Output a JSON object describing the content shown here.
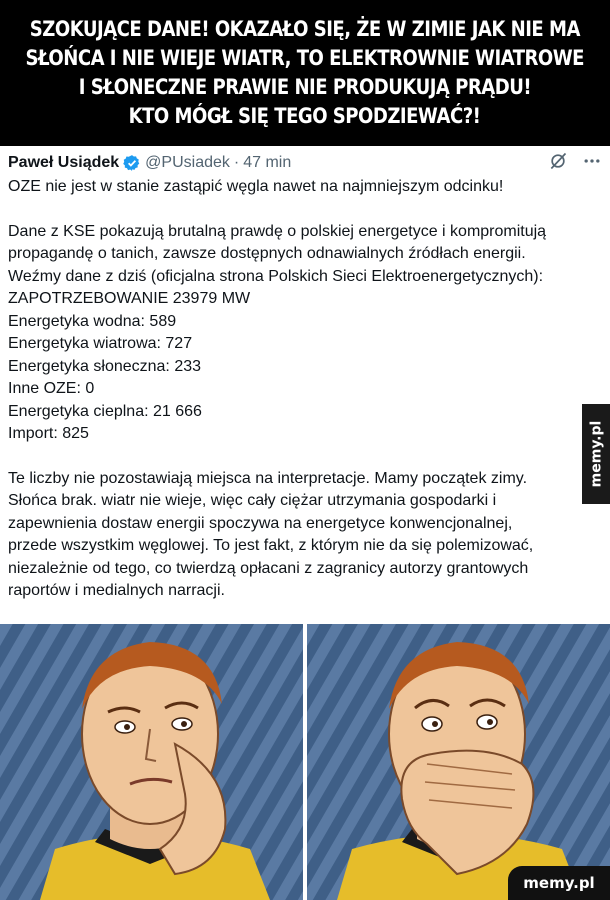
{
  "headline": {
    "lines": [
      "SZOKUJĄCE DANE! OKAZAŁO SIĘ, ŻE W ZIMIE JAK NIE MA",
      "SŁOŃCA I NIE WIEJE WIATR, TO ELEKTROWNIE WIATROWE",
      "I SŁONECZNE PRAWIE NIE PRODUKUJĄ PRĄDU!",
      "KTO MÓGŁ SIĘ TEGO SPODZIEWAĆ?!"
    ]
  },
  "tweet": {
    "author_name": "Paweł Usiądek",
    "handle": "@PUsiadek",
    "separator": "·",
    "time": "47 min",
    "icons": [
      "verified-badge-icon",
      "grok-icon",
      "more-icon"
    ],
    "colors": {
      "verified": "#1d9bf0",
      "text": "#0f1419",
      "muted": "#536471"
    },
    "paragraphs": [
      [
        "OZE nie jest w stanie zastąpić węgla nawet na najmniejszym odcinku!"
      ],
      [
        "Dane z KSE pokazują brutalną prawdę o polskiej energetyce i kompromitują",
        "propagandę o tanich, zawsze dostępnych odnawialnych źródłach energii.",
        "Weźmy dane z dziś (oficjalna strona Polskich Sieci Elektroenergetycznych):",
        "ZAPOTRZEBOWANIE 23979 MW",
        "Energetyka wodna: 589",
        "Energetyka wiatrowa: 727",
        "Energetyka słoneczna: 233",
        "Inne OZE: 0",
        "Energetyka cieplna: 21 666",
        "Import: 825"
      ],
      [
        "Te liczby nie pozostawiają miejsca na interpretacje. Mamy początek zimy.",
        "Słońca brak. wiatr nie wieje, więc cały ciężar utrzymania gospodarki i",
        "zapewnienia dostaw energii spoczywa na energetyce konwencjonalnej,",
        "przede wszystkim węglowej. To jest fakt, z którym nie da się polemizować,",
        "niezależnie od tego, co twierdzą opłacani z zagranicy autorzy grantowych",
        "raportów i medialnych narracji."
      ]
    ]
  },
  "watermark": {
    "side": "memy.pl",
    "bottom": "memy.pl"
  },
  "meme": {
    "panels": [
      "thinking-pose",
      "hand-over-mouth-pose"
    ]
  }
}
